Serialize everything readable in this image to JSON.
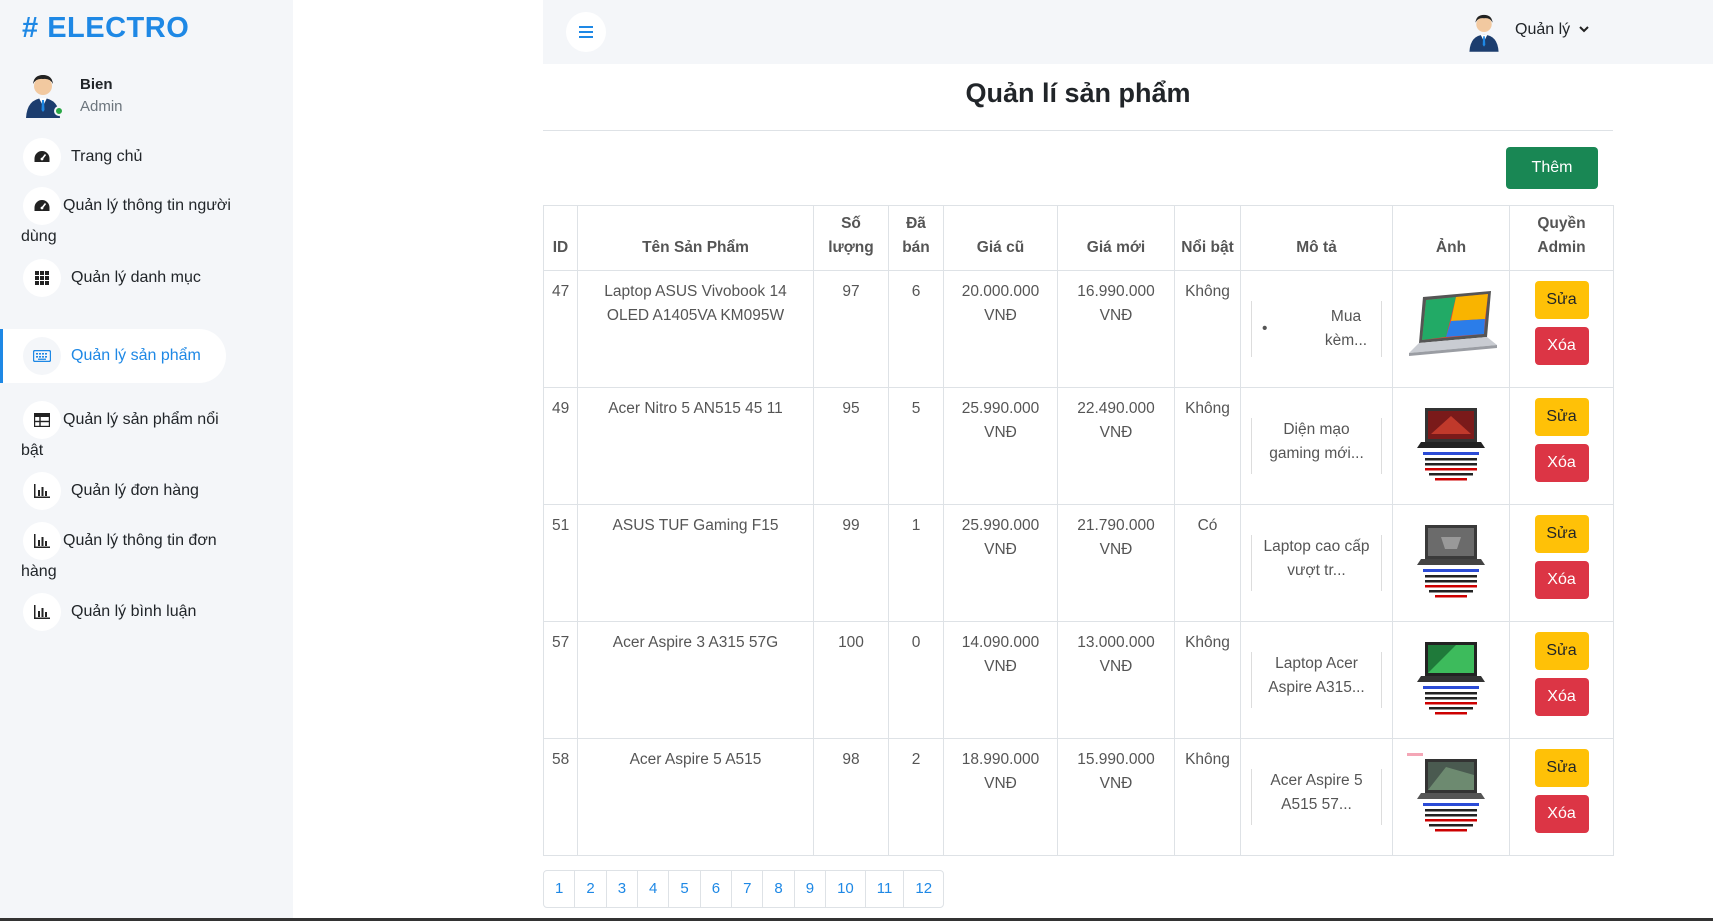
{
  "brand": {
    "hash": "#",
    "name": "ELECTRO"
  },
  "user": {
    "name": "Bien",
    "role": "Admin"
  },
  "nav": [
    {
      "label": "Trang chủ",
      "icon": "dashboard-icon"
    },
    {
      "label": "Quản lý thông tin người dùng",
      "icon": "dashboard-icon"
    },
    {
      "label": "Quản lý danh mục",
      "icon": "grid-icon"
    },
    {
      "label": "Quản lý sản phẩm",
      "icon": "keyboard-icon",
      "active": true
    },
    {
      "label": "Quản lý sản phẩm nổi bật",
      "icon": "table-icon"
    },
    {
      "label": "Quản lý đơn hàng",
      "icon": "bar-chart-icon"
    },
    {
      "label": "Quản lý thông tin đơn hàng",
      "icon": "bar-chart-icon"
    },
    {
      "label": "Quản lý bình luận",
      "icon": "bar-chart-icon"
    }
  ],
  "header": {
    "user_label": "Quản lý"
  },
  "page": {
    "title": "Quản lí sản phẩm",
    "add_label": "Thêm"
  },
  "table": {
    "headers": [
      "ID",
      "Tên Sản Phẩm",
      "Số lượng",
      "Đã bán",
      "Giá cũ",
      "Giá mới",
      "Nổi bật",
      "Mô tả",
      "Ảnh",
      "Quyền Admin"
    ],
    "rows": [
      {
        "id": "47",
        "name": "Laptop ASUS Vivobook 14 OLED A1405VA KM095W",
        "qty": "97",
        "sold": "6",
        "old_price": "20.000.000 VNĐ",
        "new_price": "16.990.000 VNĐ",
        "featured": "Không",
        "desc": "Mua kèm...",
        "desc_bullet": true,
        "img": "laptop-silver"
      },
      {
        "id": "49",
        "name": "Acer Nitro 5 AN515 45 11",
        "qty": "95",
        "sold": "5",
        "old_price": "25.990.000 VNĐ",
        "new_price": "22.490.000 VNĐ",
        "featured": "Không",
        "desc": "Diện mạo gaming mới...",
        "desc_bullet": false,
        "img": "laptop-gaming-red"
      },
      {
        "id": "51",
        "name": "ASUS TUF Gaming F15",
        "qty": "99",
        "sold": "1",
        "old_price": "25.990.000 VNĐ",
        "new_price": "21.790.000 VNĐ",
        "featured": "Có",
        "desc": "Laptop cao cấp vượt tr...",
        "desc_bullet": false,
        "img": "laptop-gray"
      },
      {
        "id": "57",
        "name": "Acer Aspire 3 A315 57G",
        "qty": "100",
        "sold": "0",
        "old_price": "14.090.000 VNĐ",
        "new_price": "13.000.000 VNĐ",
        "featured": "Không",
        "desc": "Laptop Acer Aspire A315...",
        "desc_bullet": false,
        "img": "laptop-green"
      },
      {
        "id": "58",
        "name": "Acer Aspire 5 A515",
        "qty": "98",
        "sold": "2",
        "old_price": "18.990.000 VNĐ",
        "new_price": "15.990.000 VNĐ",
        "featured": "Không",
        "desc": "Acer Aspire 5 A515 57...",
        "desc_bullet": false,
        "img": "laptop-acer"
      }
    ],
    "edit_label": "Sửa",
    "delete_label": "Xóa"
  },
  "pagination": [
    "1",
    "2",
    "3",
    "4",
    "5",
    "6",
    "7",
    "8",
    "9",
    "10",
    "11",
    "12"
  ],
  "colors": {
    "accent": "#1e88e5",
    "add": "#198754",
    "edit": "#ffc107",
    "delete": "#dc3545",
    "sidebar_bg": "#f4f6f9"
  }
}
